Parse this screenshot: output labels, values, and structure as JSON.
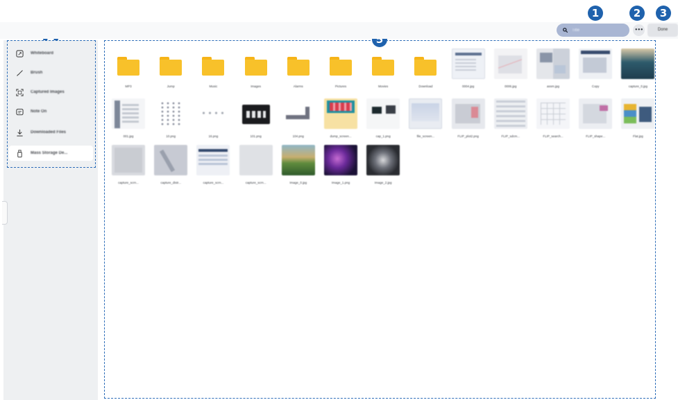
{
  "callouts": [
    "1",
    "2",
    "3",
    "4",
    "5"
  ],
  "toolbar": {
    "search_placeholder": "Title",
    "more_label": "•••",
    "done_label": "Done"
  },
  "sidebar": {
    "items": [
      {
        "label": "Whiteboard",
        "icon": "whiteboard-icon",
        "selected": false
      },
      {
        "label": "Brush",
        "icon": "brush-icon",
        "selected": false
      },
      {
        "label": "Captured Images",
        "icon": "capture-icon",
        "selected": false
      },
      {
        "label": "Note On",
        "icon": "note-icon",
        "selected": false
      },
      {
        "label": "Downloaded Files",
        "icon": "download-icon",
        "selected": false
      },
      {
        "label": "Mass Storage De...",
        "icon": "usb-storage-icon",
        "selected": true
      }
    ]
  },
  "files": [
    {
      "name": "MP3",
      "thumb": "folder"
    },
    {
      "name": "Jump",
      "thumb": "folder"
    },
    {
      "name": "Music",
      "thumb": "folder"
    },
    {
      "name": "Images",
      "thumb": "folder"
    },
    {
      "name": "Alarms",
      "thumb": "folder"
    },
    {
      "name": "Pictures",
      "thumb": "folder"
    },
    {
      "name": "Movies",
      "thumb": "folder"
    },
    {
      "name": "Download",
      "thumb": "folder"
    },
    {
      "name": "0004.jpg",
      "thumb": "doc"
    },
    {
      "name": "0006.jpg",
      "thumb": "graph"
    },
    {
      "name": "assm.jpg",
      "thumb": "collage"
    },
    {
      "name": "Copy",
      "thumb": "window"
    },
    {
      "name": "capture_0.jpg",
      "thumb": "landscape"
    },
    {
      "name": "001.jpg",
      "thumb": "bars"
    },
    {
      "name": "10.png",
      "thumb": "dots"
    },
    {
      "name": "16.png",
      "thumb": "dots-row"
    },
    {
      "name": "101.png",
      "thumb": "black"
    },
    {
      "name": "104.png",
      "thumb": "shape"
    },
    {
      "name": "dump_screen...",
      "thumb": "red"
    },
    {
      "name": "cap_1.png",
      "thumb": "capture"
    },
    {
      "name": "file_screen...",
      "thumb": "screen"
    },
    {
      "name": "FLIP_plot2.png",
      "thumb": "screen2"
    },
    {
      "name": "FLIP_sdcm...",
      "thumb": "screen3"
    },
    {
      "name": "FLIP_search...",
      "thumb": "grid2"
    },
    {
      "name": "FLIP_shape...",
      "thumb": "pink"
    },
    {
      "name": "Flat.jpg",
      "thumb": "colorful"
    },
    {
      "name": "capture_scrn...",
      "thumb": "gray"
    },
    {
      "name": "capture_distr...",
      "thumb": "gray2"
    },
    {
      "name": "capture_scrn...",
      "thumb": "window2"
    },
    {
      "name": "capture_scrn...",
      "thumb": "blank"
    },
    {
      "name": "Image_0.jpg",
      "thumb": "hills"
    },
    {
      "name": "Image_1.png",
      "thumb": "purple"
    },
    {
      "name": "Image_2.jpg",
      "thumb": "flower"
    }
  ],
  "colors": {
    "accent": "#1f62ad",
    "folder": "#f8c12a",
    "search_bg": "#a9b6d3"
  }
}
